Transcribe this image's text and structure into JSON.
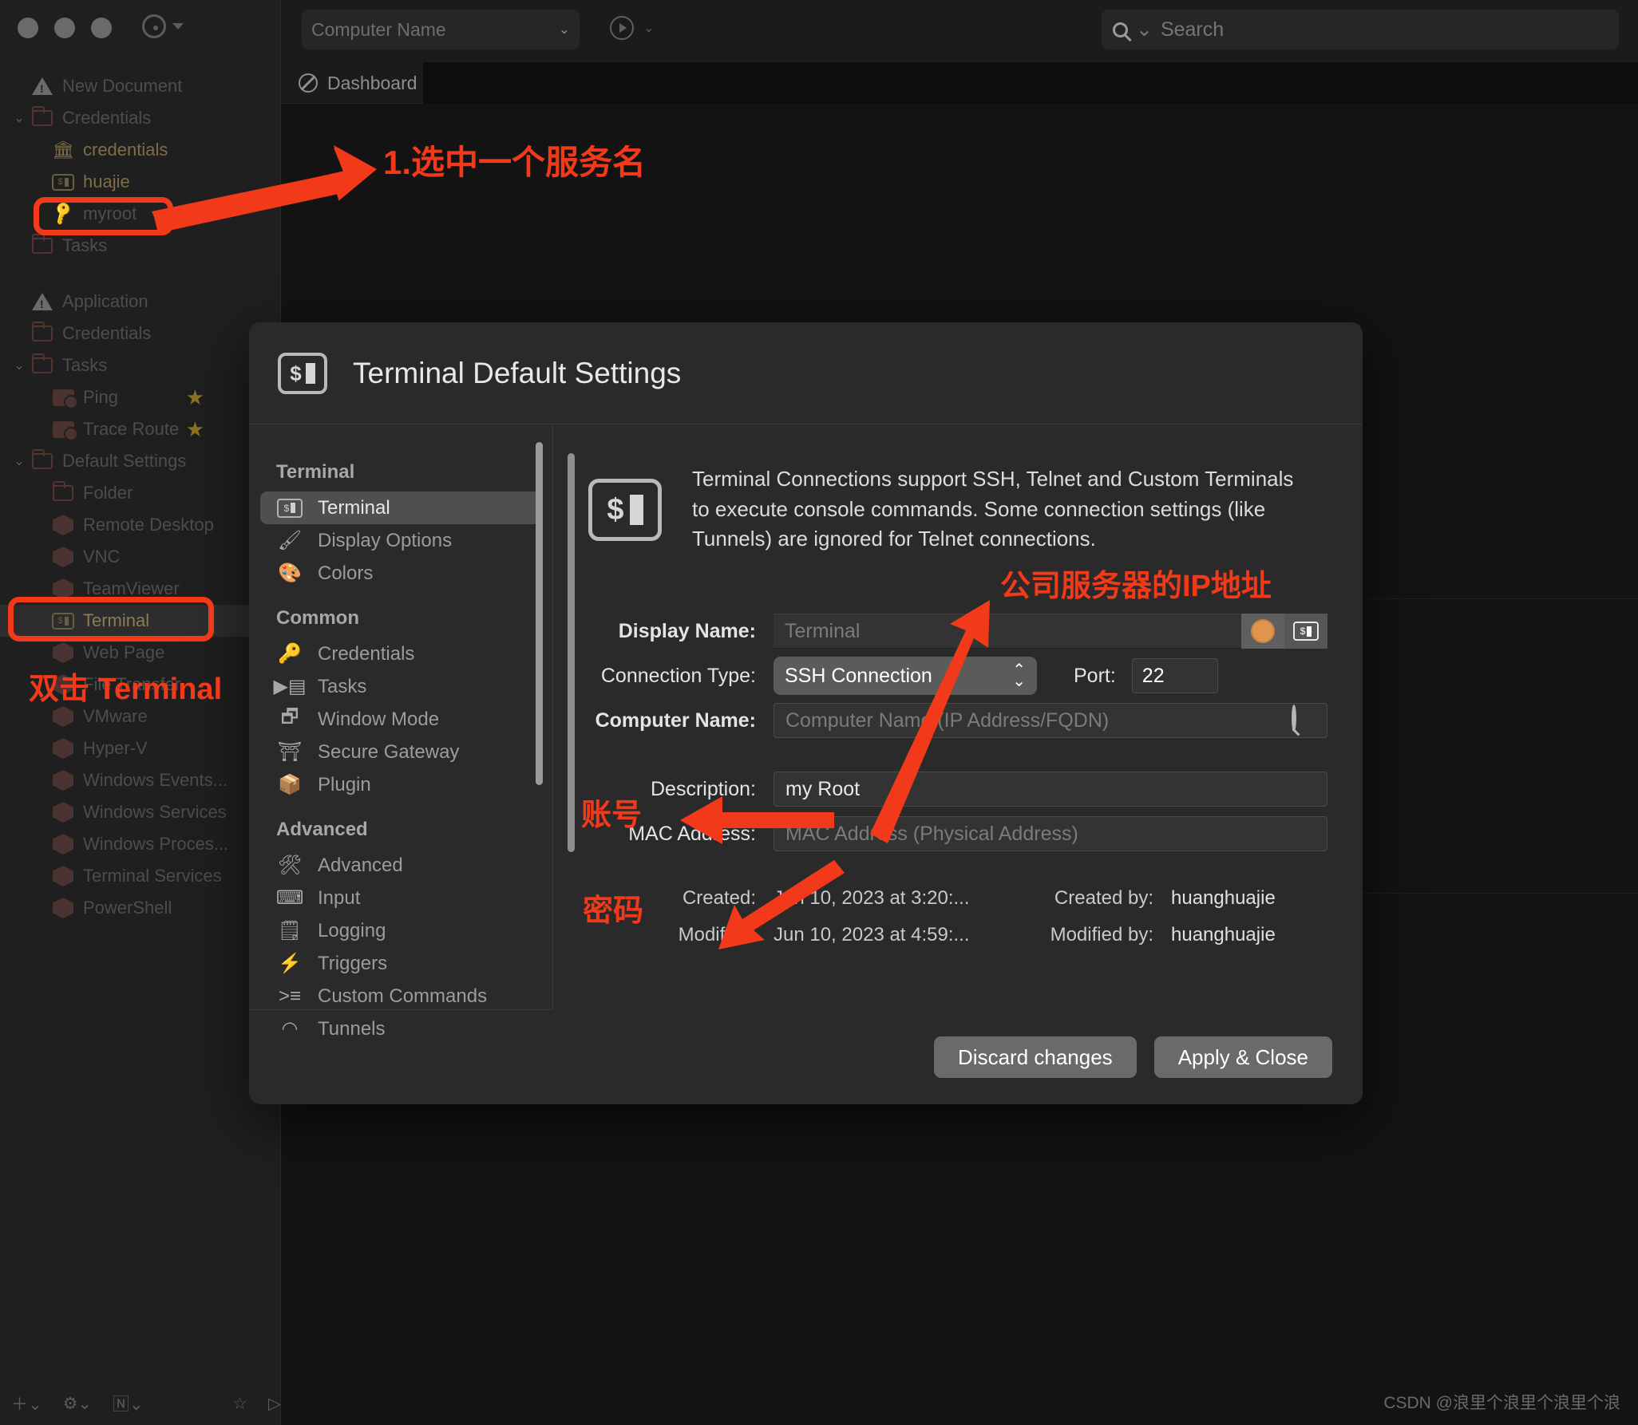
{
  "window": {
    "computer_name_placeholder": "Computer Name",
    "search_placeholder": "Search",
    "tab_label": "Dashboard"
  },
  "sidebar": {
    "groups": [
      {
        "title": "New Document",
        "items": [
          {
            "label": "Credentials",
            "icon": "folder-icon",
            "indent": 1,
            "twisty": "⌄",
            "style": "dim"
          },
          {
            "label": "credentials",
            "icon": "bank-icon",
            "indent": 2,
            "twisty": "",
            "style": "cred"
          },
          {
            "label": "huajie",
            "icon": "terminal-icon",
            "indent": 2,
            "twisty": "",
            "style": "cred"
          },
          {
            "label": "myroot",
            "icon": "key-icon",
            "indent": 2,
            "twisty": "",
            "style": "dim"
          },
          {
            "label": "Tasks",
            "icon": "folder-icon",
            "indent": 1,
            "twisty": "",
            "style": "dim"
          }
        ]
      },
      {
        "title": "Application",
        "items": [
          {
            "label": "Credentials",
            "icon": "folder-icon",
            "indent": 1,
            "twisty": "",
            "style": "dim"
          },
          {
            "label": "Tasks",
            "icon": "folder-icon",
            "indent": 1,
            "twisty": "⌄",
            "style": "dim"
          },
          {
            "label": "Ping",
            "icon": "task-icon",
            "indent": 2,
            "twisty": "",
            "style": "dim",
            "star": "★"
          },
          {
            "label": "Trace Route",
            "icon": "task-icon",
            "indent": 2,
            "twisty": "",
            "style": "dim",
            "star": "★"
          },
          {
            "label": "Default Settings",
            "icon": "folder-icon",
            "indent": 1,
            "twisty": "⌄",
            "style": "dim"
          },
          {
            "label": "Folder",
            "icon": "folder-icon",
            "indent": 2,
            "twisty": "",
            "style": "dim"
          },
          {
            "label": "Remote Desktop",
            "icon": "cube-icon",
            "indent": 2,
            "twisty": "",
            "style": "dim"
          },
          {
            "label": "VNC",
            "icon": "cube-icon",
            "indent": 2,
            "twisty": "",
            "style": "dim"
          },
          {
            "label": "TeamViewer",
            "icon": "cube-icon",
            "indent": 2,
            "twisty": "",
            "style": "dim"
          },
          {
            "label": "Terminal",
            "icon": "terminal-icon",
            "indent": 2,
            "twisty": "",
            "style": "selected"
          },
          {
            "label": "Web Page",
            "icon": "cube-icon",
            "indent": 2,
            "twisty": "",
            "style": "dim"
          },
          {
            "label": "File Transfer",
            "icon": "cube-icon",
            "indent": 2,
            "twisty": "",
            "style": "dim"
          },
          {
            "label": "VMware",
            "icon": "cube-icon",
            "indent": 2,
            "twisty": "",
            "style": "dim"
          },
          {
            "label": "Hyper-V",
            "icon": "cube-icon",
            "indent": 2,
            "twisty": "",
            "style": "dim"
          },
          {
            "label": "Windows Events...",
            "icon": "cube-icon",
            "indent": 2,
            "twisty": "",
            "style": "dim"
          },
          {
            "label": "Windows Services",
            "icon": "cube-icon",
            "indent": 2,
            "twisty": "",
            "style": "dim"
          },
          {
            "label": "Windows Proces...",
            "icon": "cube-icon",
            "indent": 2,
            "twisty": "",
            "style": "dim"
          },
          {
            "label": "Terminal Services",
            "icon": "cube-icon",
            "indent": 2,
            "twisty": "",
            "style": "dim"
          },
          {
            "label": "PowerShell",
            "icon": "cube-icon",
            "indent": 2,
            "twisty": "",
            "style": "dim"
          }
        ]
      }
    ]
  },
  "dialog": {
    "title": "Terminal Default Settings",
    "nav": [
      {
        "section": "Terminal",
        "items": [
          {
            "label": "Terminal",
            "icon": "terminal-icon",
            "active": true
          },
          {
            "label": "Display Options",
            "icon": "brush-icon",
            "active": false
          },
          {
            "label": "Colors",
            "icon": "palette-icon",
            "active": false
          }
        ]
      },
      {
        "section": "Common",
        "items": [
          {
            "label": "Credentials",
            "icon": "key-icon",
            "active": false
          },
          {
            "label": "Tasks",
            "icon": "task-icon",
            "active": false
          },
          {
            "label": "Window Mode",
            "icon": "window-icon",
            "active": false
          },
          {
            "label": "Secure Gateway",
            "icon": "gateway-icon",
            "active": false
          },
          {
            "label": "Plugin",
            "icon": "cube-icon",
            "active": false
          }
        ]
      },
      {
        "section": "Advanced",
        "items": [
          {
            "label": "Advanced",
            "icon": "tools-icon",
            "active": false
          },
          {
            "label": "Input",
            "icon": "keyboard-icon",
            "active": false
          },
          {
            "label": "Logging",
            "icon": "log-icon",
            "active": false
          },
          {
            "label": "Triggers",
            "icon": "trigger-icon",
            "active": false
          },
          {
            "label": "Custom Commands",
            "icon": "command-icon",
            "active": false
          },
          {
            "label": "Tunnels",
            "icon": "tunnel-icon",
            "active": false
          }
        ]
      }
    ],
    "description": "Terminal Connections support SSH, Telnet and Custom Terminals to execute console commands. Some connection settings (like Tunnels) are ignored for Telnet connections.",
    "form": {
      "display_name_label": "Display Name:",
      "display_name_placeholder": "Terminal",
      "connection_type_label": "Connection Type:",
      "connection_type_value": "SSH Connection",
      "port_label": "Port:",
      "port_value": "22",
      "computer_name_label": "Computer Name:",
      "computer_name_placeholder": "Computer Name (IP Address/FQDN)",
      "description_label": "Description:",
      "description_value": "my Root",
      "mac_label": "MAC Address:",
      "mac_placeholder": "MAC Address (Physical Address)"
    },
    "meta": {
      "created_label": "Created:",
      "created_value": "Jun 10, 2023 at 3:20:...",
      "created_by_label": "Created by:",
      "created_by_value": "huanghuajie",
      "modified_label": "Modified:",
      "modified_value": "Jun 10, 2023 at 4:59:...",
      "modified_by_label": "Modified by:",
      "modified_by_value": "huanghuajie"
    },
    "buttons": {
      "discard": "Discard changes",
      "apply": "Apply & Close"
    }
  },
  "annotations": [
    {
      "text": "1.选中一个服务名"
    },
    {
      "text": "双击 Terminal"
    },
    {
      "text": "公司服务器的IP地址"
    },
    {
      "text": "账号"
    },
    {
      "text": "密码"
    }
  ],
  "watermark": "CSDN @浪里个浪里个浪里个浪"
}
